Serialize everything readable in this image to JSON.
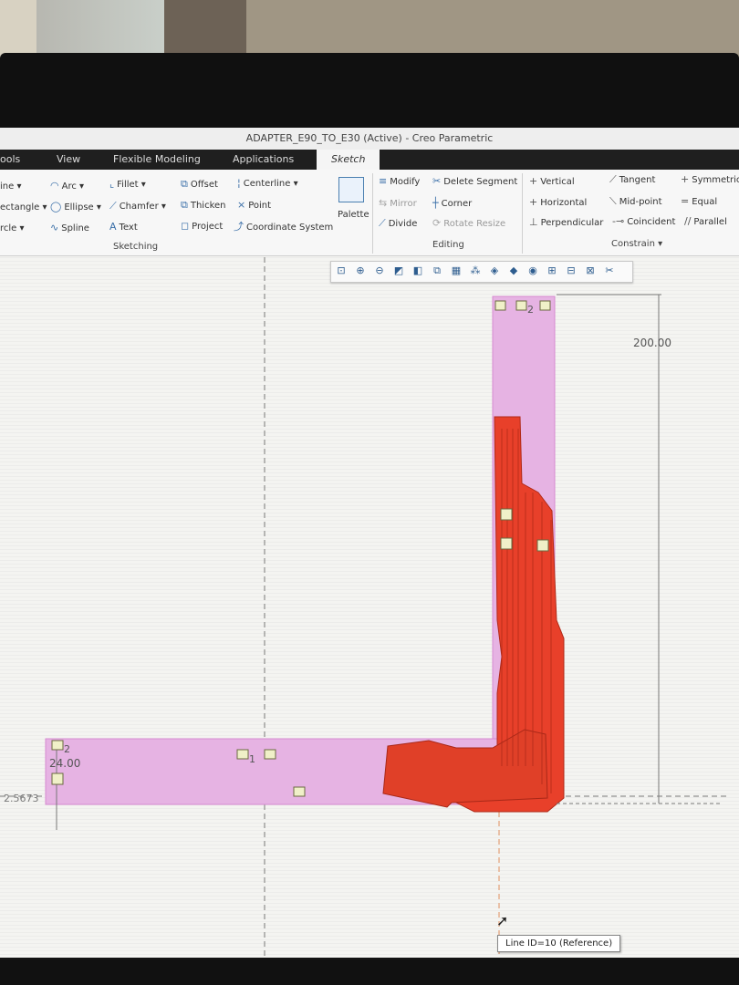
{
  "window": {
    "title": "ADAPTER_E90_TO_E30 (Active) - Creo Parametric"
  },
  "tabs": [
    "ools",
    "View",
    "Flexible Modeling",
    "Applications",
    "Sketch"
  ],
  "ribbon": {
    "sketching": {
      "group_label": "Sketching",
      "col1": [
        "ine ▾",
        "ectangle ▾",
        "rcle ▾"
      ],
      "arc": "Arc ▾",
      "ellipse": "Ellipse ▾",
      "spline": "Spline",
      "fillet": "Fillet ▾",
      "chamfer": "Chamfer ▾",
      "text": "Text",
      "offset": "Offset",
      "thicken": "Thicken",
      "project": "Project",
      "centerline": "Centerline ▾",
      "point": "Point",
      "coordinate_system": "Coordinate System",
      "palette": "Palette"
    },
    "editing": {
      "group_label": "Editing",
      "modify": "Modify",
      "delete_segment": "Delete Segment",
      "mirror": "Mirror",
      "corner": "Corner",
      "divide": "Divide",
      "rotate_resize": "Rotate Resize"
    },
    "constrain": {
      "group_label": "Constrain ▾",
      "vertical": "Vertical",
      "tangent": "Tangent",
      "symmetric": "Symmetric",
      "horizontal": "Horizontal",
      "midpoint": "Mid-point",
      "equal": "Equal",
      "perpendicular": "Perpendicular",
      "coincident": "Coincident",
      "parallel": "Parallel"
    }
  },
  "dimensions": {
    "height": "200.00",
    "width": "24.00",
    "baseline": "2.5673",
    "constraint_2a": "2",
    "constraint_1": "1",
    "constraint_2b": "2"
  },
  "tooltip": "Line ID=10 (Reference)",
  "colors": {
    "sketch_fill": "#e6b3e3",
    "part": "#e8402a",
    "ribbon_accent": "#3a6fa8"
  }
}
